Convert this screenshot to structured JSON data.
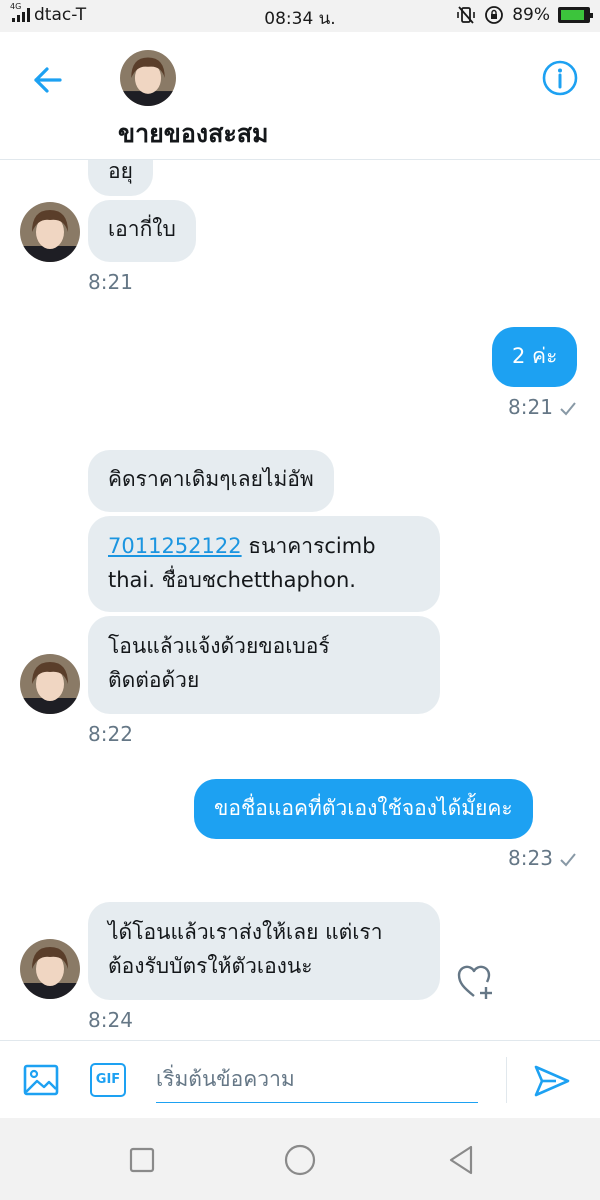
{
  "status_bar": {
    "network_type": "4G",
    "carrier": "dtac-T",
    "time": "08:34 น.",
    "battery_percent": "89%",
    "battery_level": 0.89
  },
  "header": {
    "title": "ขายของสะสม"
  },
  "messages": [
    {
      "direction": "received",
      "text": "อยุ"
    },
    {
      "direction": "received",
      "text": "เอากี่ใบ"
    },
    {
      "direction": "received",
      "timestamp": "8:21"
    },
    {
      "direction": "sent",
      "text": "2 ค่ะ",
      "timestamp": "8:21",
      "status": "read"
    },
    {
      "direction": "received",
      "text": "คิดราคาเดิมๆเลยไม่อัพ"
    },
    {
      "direction": "received",
      "link": "7011252122",
      "text_line1": " ธนาคารcimb",
      "text_line2": "thai. ชื่อบชchetthaphon."
    },
    {
      "direction": "received",
      "text_line1": "โอนแล้วแจ้งด้วยขอเบอร์",
      "text_line2": "ติดต่อด้วย",
      "timestamp": "8:22"
    },
    {
      "direction": "sent",
      "text": "ขอชื่อแอคที่ตัวเองใช้จองได้มั้ยคะ",
      "timestamp": "8:23",
      "status": "read"
    },
    {
      "direction": "received",
      "text_line1": "ได้โอนแล้วเราส่งให้เลย แต่เรา",
      "text_line2": "ต้องรับบัตรให้ตัวเองนะ",
      "timestamp": "8:24"
    }
  ],
  "composer": {
    "gif_label": "GIF",
    "placeholder": "เริ่มต้นข้อความ"
  },
  "colors": {
    "accent": "#1da1f2",
    "received_bubble": "#e6ecf0",
    "timestamp": "#657786"
  }
}
